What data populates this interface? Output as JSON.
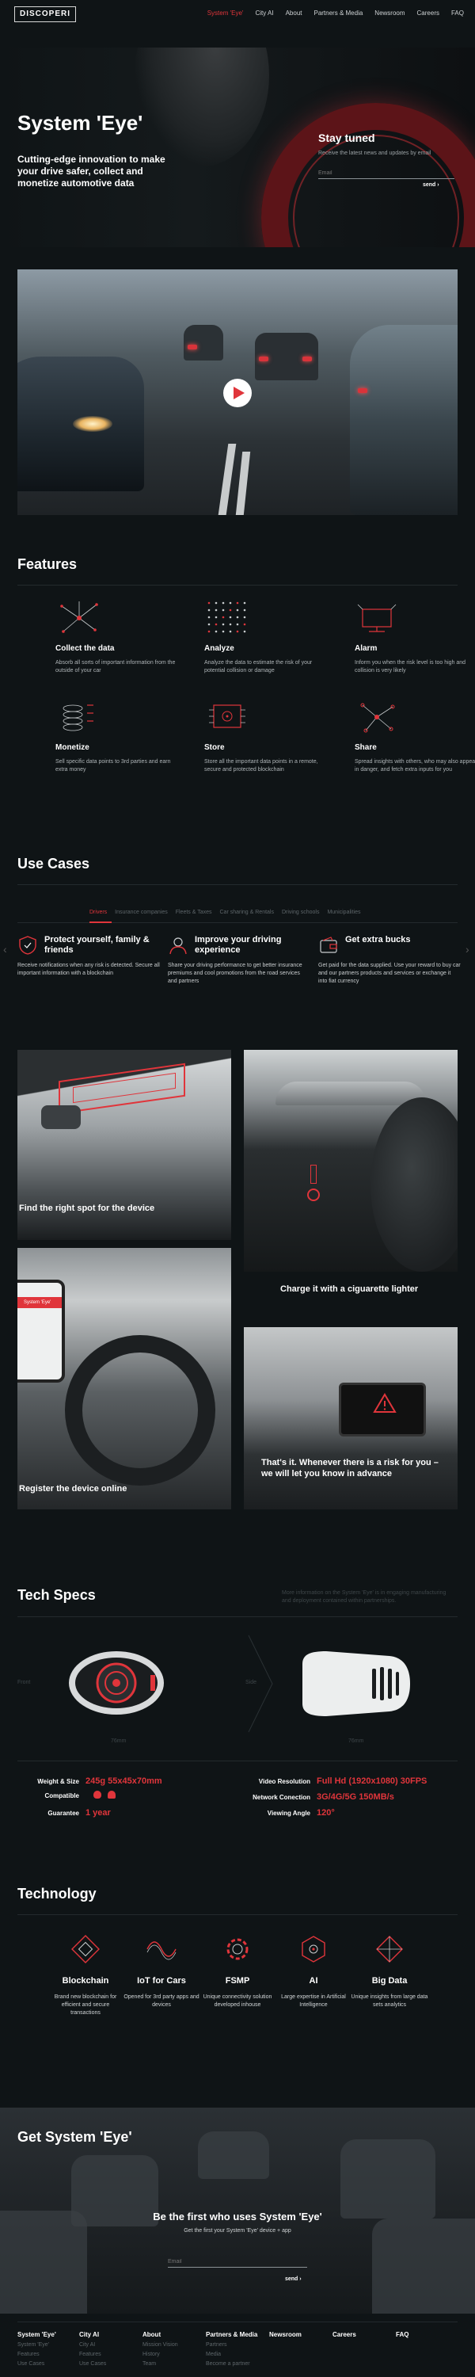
{
  "nav": {
    "logo": "DISCOPERI",
    "links": [
      "System 'Eye'",
      "City AI",
      "About",
      "Partners & Media",
      "Newsroom",
      "Careers",
      "FAQ"
    ],
    "active_index": 0
  },
  "hero": {
    "title": "System 'Eye'",
    "subtitle": "Cutting-edge innovation to make your drive safer, collect and monetize automotive data",
    "stay_title": "Stay tuned",
    "stay_subtitle": "Receive the latest news and updates by email",
    "email_placeholder": "Email",
    "send_label": "send  ›"
  },
  "features": {
    "title": "Features",
    "items": [
      {
        "icon": "network-icon",
        "name": "Collect the data",
        "desc": "Absorb all sorts of important information from the outside of your car"
      },
      {
        "icon": "dots-grid-icon",
        "name": "Analyze",
        "desc": "Analyze the data to estimate the risk of your potential collision or damage"
      },
      {
        "icon": "alarm-screen-icon",
        "name": "Alarm",
        "desc": "Inform you when the risk level is too high and collision is very likely"
      },
      {
        "icon": "coin-stack-icon",
        "name": "Monetize",
        "desc": "Sell specific data points to 3rd parties and earn extra money"
      },
      {
        "icon": "chip-icon",
        "name": "Store",
        "desc": "Store all the important data points in a remote, secure and protected blockchain"
      },
      {
        "icon": "share-nodes-icon",
        "name": "Share",
        "desc": "Spread insights with others, who may also appear in danger, and fetch extra inputs for you"
      }
    ]
  },
  "use_cases": {
    "title": "Use Cases",
    "tabs": [
      "Drivers",
      "Insurance companies",
      "Fleets & Taxes",
      "Car sharing & Rentals",
      "Driving schools",
      "Municipalities"
    ],
    "active_tab": 0,
    "items": [
      {
        "icon": "shield-icon",
        "title": "Protect yourself, family & friends",
        "desc": "Receive notifications when any risk is detected. Secure all important information with a blockchain"
      },
      {
        "icon": "driver-icon",
        "title": "Improve your driving experience",
        "desc": "Share your driving performance to get better insurance premiums and cool promotions from the road services and partners"
      },
      {
        "icon": "wallet-icon",
        "title": "Get extra bucks",
        "desc": "Get paid for the data supplied. Use your reward to buy car and our partners products and services or exchange it into fiat currency"
      }
    ]
  },
  "steps": [
    "Find the right spot for the device",
    "Charge it with a ciguarette lighter",
    "Register the device online",
    "That's it. Whenever there is a risk for you – we will let you know in advance"
  ],
  "phone_label": "System 'Eye'",
  "tech_specs": {
    "title": "Tech Specs",
    "intro": "More information on the System 'Eye' is in engaging manufacturing and deployment contained within partnerships.",
    "left_label": "Front",
    "right_label": "Side",
    "caption_left": "76mm",
    "caption_right": "76mm",
    "specs_left": [
      {
        "label": "Weight & Size",
        "value": "245g 55x45x70mm"
      },
      {
        "label": "Compatible",
        "value": ""
      },
      {
        "label": "Guarantee",
        "value": "1 year"
      }
    ],
    "specs_right": [
      {
        "label": "Video Resolution",
        "value": "Full Hd (1920x1080) 30FPS"
      },
      {
        "label": "Network Conection",
        "value": "3G/4G/5G 150MB/s"
      },
      {
        "label": "Viewing Angle",
        "value": "120°"
      }
    ]
  },
  "technology": {
    "title": "Technology",
    "items": [
      {
        "icon": "blockchain-icon",
        "name": "Blockchain",
        "desc": "Brand new blockchain for efficient and secure transactions"
      },
      {
        "icon": "wave-icon",
        "name": "IoT for Cars",
        "desc": "Opened for 3rd party apps and devices"
      },
      {
        "icon": "gear-icon",
        "name": "FSMP",
        "desc": "Unique connectivity solution developed inhouse"
      },
      {
        "icon": "ai-icon",
        "name": "AI",
        "desc": "Large expertise in Artificial Intelligence"
      },
      {
        "icon": "diamond-icon",
        "name": "Big Data",
        "desc": "Unique insights from large data sets analytics"
      }
    ]
  },
  "get_system": {
    "title": "Get System 'Eye'",
    "heading": "Be the first who uses System 'Eye'",
    "subtitle": "Get the first your System 'Eye' device + app",
    "email_placeholder": "Email",
    "send_label": "send  ›"
  },
  "footer": {
    "columns": [
      {
        "head": "System 'Eye'",
        "items": [
          "System 'Eye'",
          "Features",
          "Use Cases"
        ]
      },
      {
        "head": "City AI",
        "items": [
          "City AI",
          "Features",
          "Use Cases"
        ]
      },
      {
        "head": "About",
        "items": [
          "Mission Vision",
          "History",
          "Team"
        ]
      },
      {
        "head": "Partners & Media",
        "items": [
          "Partners",
          "Media",
          "Become a partner"
        ]
      },
      {
        "head": "Newsroom",
        "items": []
      },
      {
        "head": "Careers",
        "items": []
      },
      {
        "head": "FAQ",
        "items": []
      }
    ]
  },
  "colors": {
    "accent": "#e0353b",
    "background": "#0f1416"
  }
}
